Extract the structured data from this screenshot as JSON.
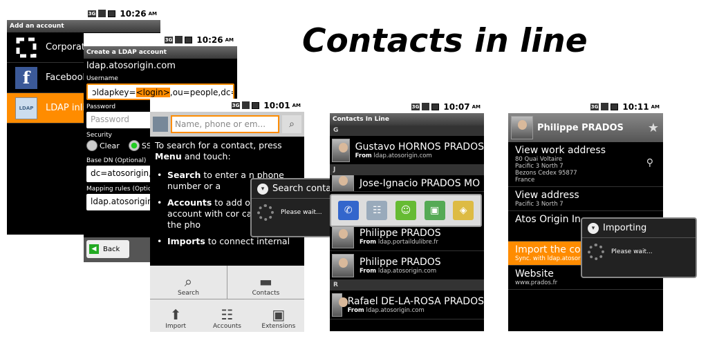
{
  "title": "Contacts in line",
  "screen1": {
    "time": "10:26",
    "ampm": "AM",
    "header": "Add an account",
    "items": [
      {
        "label": "Corporate",
        "icon": "corporate-icon"
      },
      {
        "label": "Facebook",
        "icon": "facebook-icon"
      },
      {
        "label": "LDAP inline",
        "icon": "ldap-icon",
        "badge": "LDAP"
      }
    ]
  },
  "screen2": {
    "time": "10:26",
    "ampm": "AM",
    "header": "Create a LDAP account",
    "host": "ldap.atosorigin.com",
    "username_label": "Username",
    "username_pre": "ɔldapkey=",
    "username_hl": "<login>",
    "username_post": ",ou=people,dc=atos",
    "password_label": "Password",
    "password_placeholder": "Password",
    "security_label": "Security",
    "security_clear": "Clear",
    "security_ssl": "SSL",
    "basedn_label": "Base DN (Optional)",
    "basedn_value": "dc=atosorigin,dc",
    "mapping_label": "Mapping rules (Optio",
    "mapping_value": "ldap.atosorigin.",
    "back_label": "Back"
  },
  "screen3": {
    "time": "10:01",
    "ampm": "AM",
    "search_placeholder": "Name, phone or em...",
    "intro_pre": "To search for a contact, press ",
    "intro_menu": "Menu",
    "intro_post": " and touch:",
    "bullets": [
      {
        "bold": "Search",
        "text": " to enter a n phone number or a"
      },
      {
        "bold": "Accounts",
        "text": " to add o an account with cor can sync to the pho"
      },
      {
        "bold": "Imports",
        "text": " to connect internal"
      }
    ],
    "menu": [
      {
        "label": "Search",
        "icon": "magnifier-icon"
      },
      {
        "label": "Contacts",
        "icon": "folder-icon"
      },
      {
        "label": "Import",
        "icon": "import-icon"
      },
      {
        "label": "Accounts",
        "icon": "accounts-icon"
      },
      {
        "label": "",
        "icon": "blank"
      },
      {
        "label": "Extensions",
        "icon": "extensions-icon"
      }
    ],
    "dialog_title": "Search conta",
    "dialog_body": "Please wait..."
  },
  "screen4": {
    "time": "10:07",
    "ampm": "AM",
    "header": "Contacts In Line",
    "sections": [
      {
        "letter": "G",
        "rows": [
          {
            "name": "Gustavo HORNOS PRADOS",
            "from": "From",
            "domain": "ldap.atosorigin.com"
          }
        ]
      },
      {
        "letter": "J",
        "rows": [
          {
            "name": "Jose-Ignacio PRADOS MO",
            "from": "",
            "domain": ""
          }
        ]
      },
      {
        "letter": "",
        "rows": [
          {
            "name": "Philippe PRADOS",
            "from": "From",
            "domain": "ldap.portaildulibre.fr"
          },
          {
            "name": "Philippe PRADOS",
            "from": "From",
            "domain": "ldap.atosorigin.com"
          }
        ]
      },
      {
        "letter": "R",
        "rows": [
          {
            "name": "Rafael DE-LA-ROSA PRADOS",
            "from": "From",
            "domain": "ldap.atosorigin.com"
          }
        ]
      }
    ],
    "quick_contact": [
      "phone-icon",
      "contact-card-icon",
      "sms-icon",
      "picture-icon",
      "map-icon"
    ]
  },
  "screen5": {
    "time": "10:11",
    "ampm": "AM",
    "name": "Philippe PRADOS",
    "rows": [
      {
        "title": "View work address",
        "lines": [
          "80 Quai Voltaire",
          "Pacific 3 North 7",
          "Bezons Cedex 95877",
          "France"
        ]
      },
      {
        "title": "View address",
        "lines": [
          "Pacific 3 North 7"
        ]
      },
      {
        "title": "Atos Origin In",
        "lines": []
      },
      {
        "title": "Import the contacts",
        "lines": [
          "Sync. with ldap.atosorigin.com"
        ]
      },
      {
        "title": "Website",
        "lines": [
          "www.prados.fr"
        ]
      }
    ],
    "dialog_title": "Importing",
    "dialog_body": "Please wait..."
  }
}
